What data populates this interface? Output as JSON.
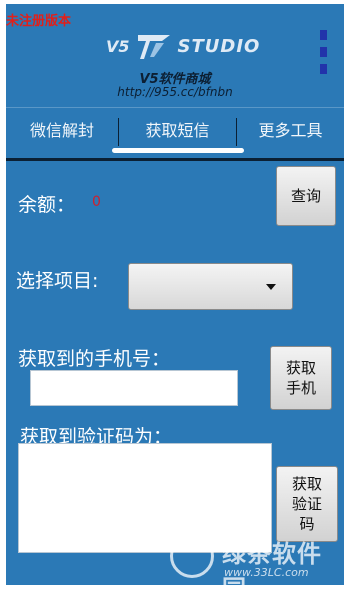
{
  "header": {
    "unregistered": "未注册版本",
    "brand_v5": "V5",
    "brand_studio": "STUDIO",
    "brand_cn": "V5软件商城",
    "brand_url": "http://955.cc/bfnbn",
    "menu_icon": "vertical-menu-icon"
  },
  "tabs": [
    {
      "label": "微信解封"
    },
    {
      "label": "获取短信",
      "active": true
    },
    {
      "label": "更多工具"
    }
  ],
  "balance": {
    "label": "余额：",
    "value": "0",
    "query_button": "查询"
  },
  "project": {
    "label": "选择项目:",
    "selected": ""
  },
  "phone": {
    "label": "获取到的手机号：",
    "value": "",
    "button": "获取\n手机"
  },
  "code": {
    "label": "获取到验证码为：",
    "value": "",
    "button": "获取\n验证\n码"
  },
  "watermark": {
    "text": "绿茶软件园",
    "url": "www.33LC.com"
  },
  "colors": {
    "background": "#2b79b6",
    "unregistered": "#e0201b",
    "balance_value": "#d0202c",
    "menu_icon": "#2233aa"
  }
}
